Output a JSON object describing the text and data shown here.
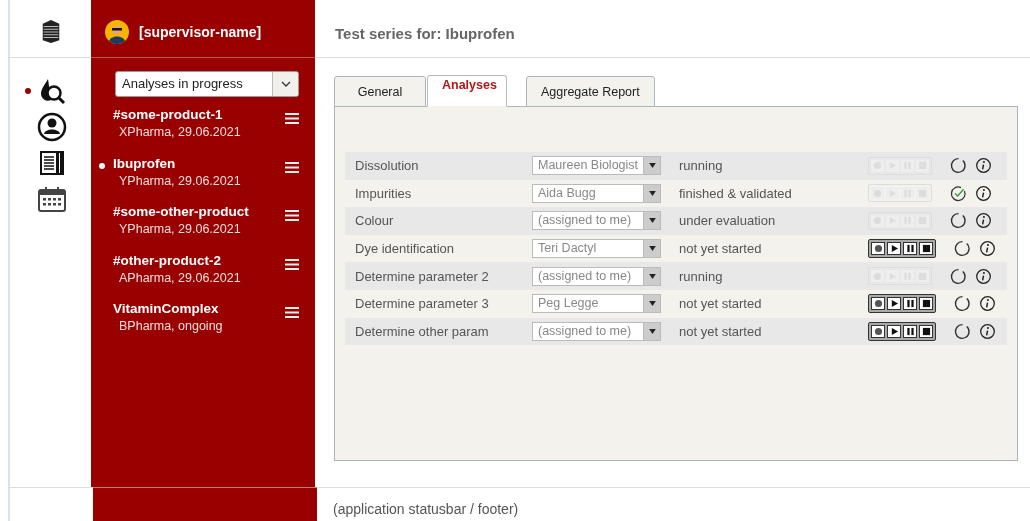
{
  "nav_items": [
    {
      "selected": true
    },
    {
      "selected": false
    },
    {
      "selected": false
    },
    {
      "selected": false
    }
  ],
  "user": {
    "name": "[supervisor-name]"
  },
  "filter": {
    "value": "Analyses in progress"
  },
  "products": [
    {
      "name": "#some-product-1",
      "detail": "XPharma, 29.06.2021",
      "selected": false
    },
    {
      "name": "Ibuprofen",
      "detail": "YPharma, 29.06.2021",
      "selected": true
    },
    {
      "name": "#some-other-product",
      "detail": "YPharma, 29.06.2021",
      "selected": false
    },
    {
      "name": "#other-product-2",
      "detail": "APharma, 29.06.2021",
      "selected": false
    },
    {
      "name": "VitaminComplex",
      "detail": "BPharma, ongoing",
      "selected": false
    }
  ],
  "title": "Test series for: Ibuprofen",
  "tabs": [
    {
      "label": "General",
      "selected": false
    },
    {
      "label": "Analyses",
      "selected": true
    },
    {
      "label": "Aggregate Report",
      "selected": false
    }
  ],
  "analyses": [
    {
      "name": "Dissolution",
      "assignee": "Maureen Biologist",
      "status": "running",
      "controls_enabled": false,
      "validated": false
    },
    {
      "name": "Impurities",
      "assignee": "Aida Bugg",
      "status": "finished & validated",
      "controls_enabled": false,
      "validated": true
    },
    {
      "name": "Colour",
      "assignee": "(assigned to me)",
      "status": "under evaluation",
      "controls_enabled": false,
      "validated": false
    },
    {
      "name": "Dye identification",
      "assignee": "Teri Dactyl",
      "status": "not yet started",
      "controls_enabled": true,
      "validated": false
    },
    {
      "name": "Determine parameter 2",
      "assignee": "(assigned to me)",
      "status": "running",
      "controls_enabled": false,
      "validated": false
    },
    {
      "name": "Determine parameter 3",
      "assignee": "Peg Legge",
      "status": "not yet started",
      "controls_enabled": true,
      "validated": false
    },
    {
      "name": "Determine other param",
      "assignee": "(assigned to me)",
      "status": "not yet started",
      "controls_enabled": true,
      "validated": false
    }
  ],
  "status_bar": "(application statusbar / footer)"
}
